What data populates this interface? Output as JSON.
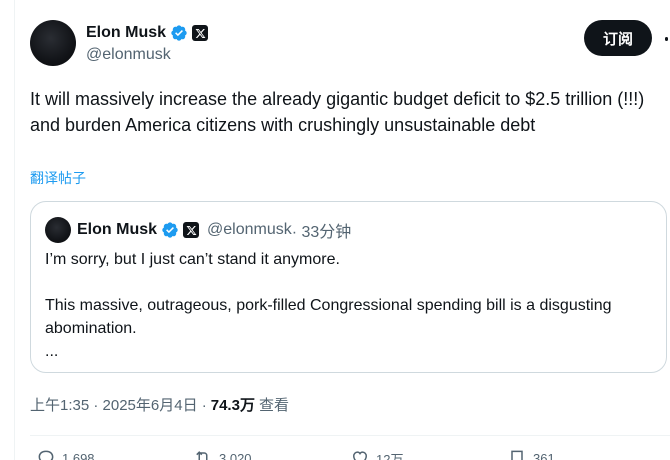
{
  "author": {
    "display_name": "Elon Musk",
    "handle": "@elonmusk"
  },
  "subscribe_label": "订阅",
  "tweet_text": "It will massively increase the already gigantic budget deficit to $2.5 trillion (!!!) and burden America citizens with crushingly unsustainable debt",
  "translate_label": "翻译帖子",
  "quote": {
    "display_name": "Elon Musk",
    "handle": "@elonmusk",
    "time": "· 33分钟",
    "line1": "I’m sorry, but I just can’t stand it anymore.",
    "line2": "This massive, outrageous, pork-filled Congressional spending bill is a disgusting abomination.",
    "line3": "..."
  },
  "meta": {
    "timestamp": "上午1:35 · 2025年6月4日 · ",
    "views": "74.3万",
    "views_label": "查看"
  },
  "actions": {
    "replies": "1,698",
    "reposts": "3,020",
    "likes": "12万",
    "bookmarks": "361"
  },
  "colors": {
    "accent": "#1d9bf0",
    "verified": "#1d9bf0",
    "text": "#0f1419",
    "secondary": "#536471"
  },
  "icons": [
    "verified-badge-icon",
    "x-logo-icon",
    "more-icon",
    "reply-icon",
    "repost-icon",
    "like-icon",
    "bookmark-icon"
  ]
}
